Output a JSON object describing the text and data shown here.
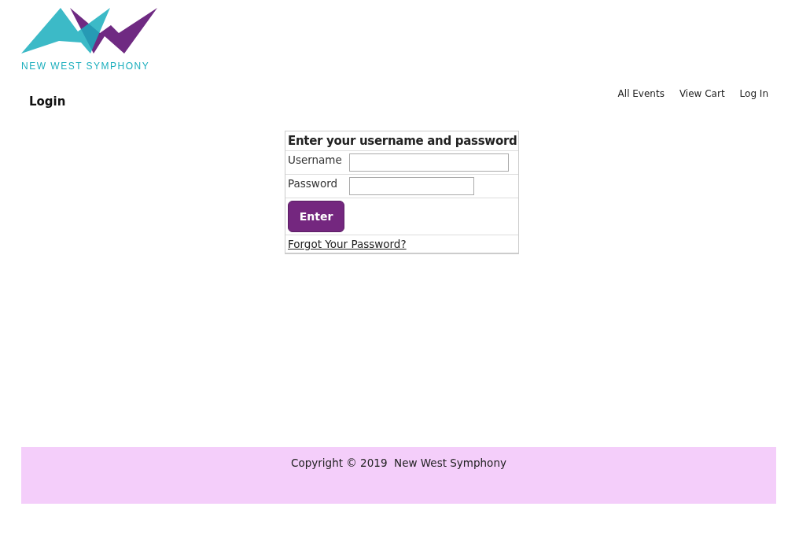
{
  "logo": {
    "text": "NEW WEST SYMPHONY"
  },
  "page_title": "Login",
  "nav": [
    "All Events",
    "View Cart",
    "Log In"
  ],
  "login_form": {
    "heading": "Enter your username and password",
    "fields": [
      {
        "label": "Username"
      },
      {
        "label": "Password"
      }
    ],
    "submit": "Enter",
    "forgot_link": "Forgot Your Password?"
  },
  "footer": {
    "text": "Copyright © 2019  New West Symphony"
  }
}
